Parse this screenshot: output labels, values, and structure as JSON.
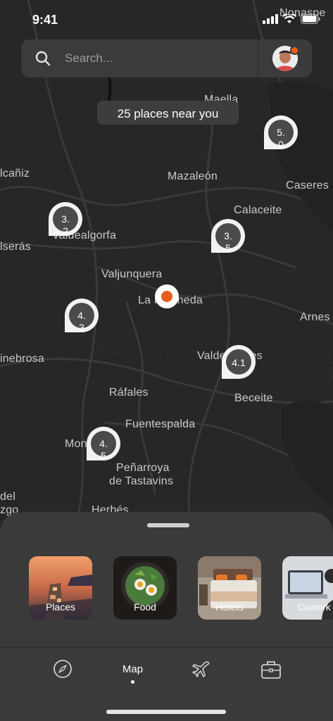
{
  "status": {
    "time": "9:41"
  },
  "search": {
    "placeholder": "Search..."
  },
  "map": {
    "near_text": "25 places near you",
    "places": [
      "Nonaspe",
      "Maella",
      "Mazaleón",
      "Caseres",
      "lcañiz",
      "Calaceite",
      "Valdealgorfa",
      "lserás",
      "Valjunquera",
      "La Fresneda",
      "Arnes",
      "inebrosa",
      "Valderrobres",
      "Beceite",
      "Ráfales",
      "Fuentespalda",
      "Monroyo",
      "Peñarroya",
      "de Tastavins",
      "del",
      "zgo",
      "Herbés"
    ],
    "pins": [
      "5.\n0",
      "3.\n2",
      "3.\n5",
      "4.\n3",
      "4.1",
      "4.\n5"
    ],
    "accent_color": "#e85d1c"
  },
  "categories": [
    {
      "label": "Places",
      "icon": "cliff-village-photo"
    },
    {
      "label": "Food",
      "icon": "food-plate-photo"
    },
    {
      "label": "Hotels",
      "icon": "hotel-room-photo"
    },
    {
      "label": "Cowork",
      "icon": "cowork-laptop-photo"
    }
  ],
  "nav": {
    "items": [
      {
        "icon": "compass-icon"
      },
      {
        "label": "Map"
      },
      {
        "icon": "airplane-icon"
      },
      {
        "icon": "briefcase-icon"
      }
    ]
  }
}
